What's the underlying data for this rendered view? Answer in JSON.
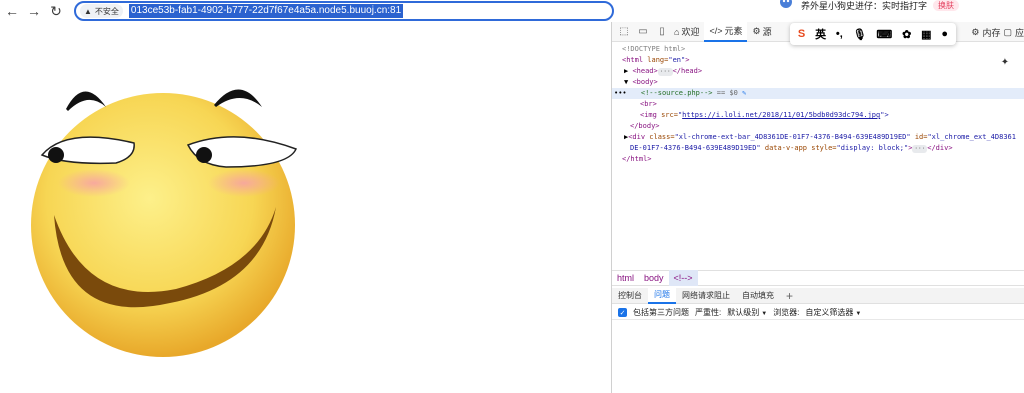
{
  "browser": {
    "security_label": "不安全",
    "url": "013ce53b-fab1-4902-b777-22d7f67e4a5a.node5.buuoj.cn:81",
    "top_right_text": "养外星小狗史进仔：实时指打字",
    "switch_label": "换肤"
  },
  "devtools": {
    "tabs": [
      {
        "label": "欢迎"
      },
      {
        "label": "元素"
      },
      {
        "label": "源"
      }
    ],
    "right_tabs": [
      {
        "label": "内存"
      },
      {
        "label": "应"
      }
    ],
    "ime": {
      "logo": "S",
      "lang": "英"
    },
    "code_lines": {
      "l1": "<!DOCTYPE html>",
      "l2_tag": "<html",
      "l2_attr": " lang=",
      "l2_val": "\"en\"",
      "l2_end": ">",
      "l3": "<head>",
      "l3_end": "</head>",
      "l4": "<body>",
      "l5_cmt": "<!--source.php-->",
      "l5_sel": " == $0",
      "l6": "<br>",
      "l7_tag": "<img",
      "l7_attr": " src=",
      "l7_link": "https://i.loli.net/2018/11/01/5bdb0d93dc794.jpg",
      "l7_end": "\">",
      "l8": "</body>",
      "l9_a": "<div",
      "l9_b": " class=",
      "l9_c": "\"xl-chrome-ext-bar_4D8361DE-01F7-4376-B494-639E489D19ED\"",
      "l9_d": " id=",
      "l9_e": "\"xl_chrome_ext_4D8361",
      "l10_a": "DE-01F7-4376-B494-639E489D19ED\"",
      "l10_b": " data-v-app",
      "l10_c": " style=",
      "l10_d": "\"display: block;\"",
      "l10_e": ">",
      "l10_f": "</div>",
      "l11": "</html>"
    },
    "breadcrumb": [
      "html",
      "body",
      "<!-->"
    ],
    "drawer_tabs": [
      {
        "label": "控制台"
      },
      {
        "label": "问题"
      },
      {
        "label": "网络请求阻止"
      },
      {
        "label": "自动填充"
      },
      {
        "label": "+"
      }
    ],
    "filter": {
      "include_third_party": "包括第三方问题",
      "severity_label": "严重性:",
      "severity_value": "默认级别",
      "browser_label": "浏览器:",
      "browser_value": "自定义筛选器"
    }
  }
}
